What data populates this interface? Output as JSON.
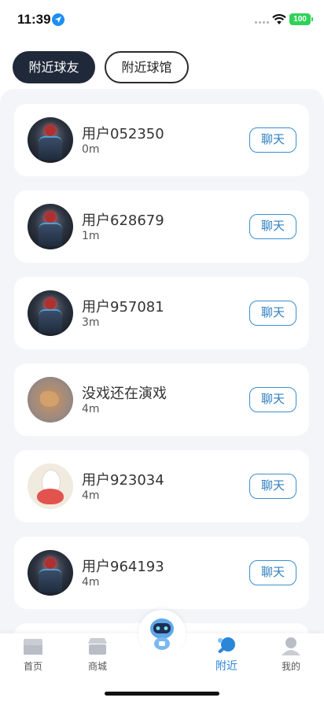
{
  "status_bar": {
    "time": "11:39",
    "battery": "100",
    "icons": [
      "location-arrow-icon",
      "signal-icon",
      "wifi-icon",
      "battery-icon"
    ]
  },
  "tabs": [
    {
      "label": "附近球友",
      "active": true
    },
    {
      "label": "附近球馆",
      "active": false
    }
  ],
  "users": [
    {
      "name": "用户052350",
      "distance": "0m",
      "avatar": "robot-avatar",
      "chat_label": "聊天"
    },
    {
      "name": "用户628679",
      "distance": "1m",
      "avatar": "robot-avatar",
      "chat_label": "聊天"
    },
    {
      "name": "用户957081",
      "distance": "3m",
      "avatar": "robot-avatar",
      "chat_label": "聊天"
    },
    {
      "name": "没戏还在演戏",
      "distance": "4m",
      "avatar": "sand-art-avatar",
      "chat_label": "聊天"
    },
    {
      "name": "用户923034",
      "distance": "4m",
      "avatar": "bunny-strawberry-avatar",
      "chat_label": "聊天"
    },
    {
      "name": "用户964193",
      "distance": "4m",
      "avatar": "robot-avatar",
      "chat_label": "聊天"
    }
  ],
  "tabbar": {
    "items": [
      {
        "label": "首页",
        "icon": "home-icon",
        "active": false
      },
      {
        "label": "商城",
        "icon": "shop-icon",
        "active": false
      },
      {
        "label": "",
        "icon": "ai-robot-icon",
        "active": false
      },
      {
        "label": "附近",
        "icon": "ping-pong-icon",
        "active": true
      },
      {
        "label": "我的",
        "icon": "profile-icon",
        "active": false
      }
    ]
  },
  "colors": {
    "accent": "#2b86d8",
    "tab_active_bg": "#1f2939",
    "list_bg": "#f3f5f9",
    "battery": "#2fd158"
  }
}
